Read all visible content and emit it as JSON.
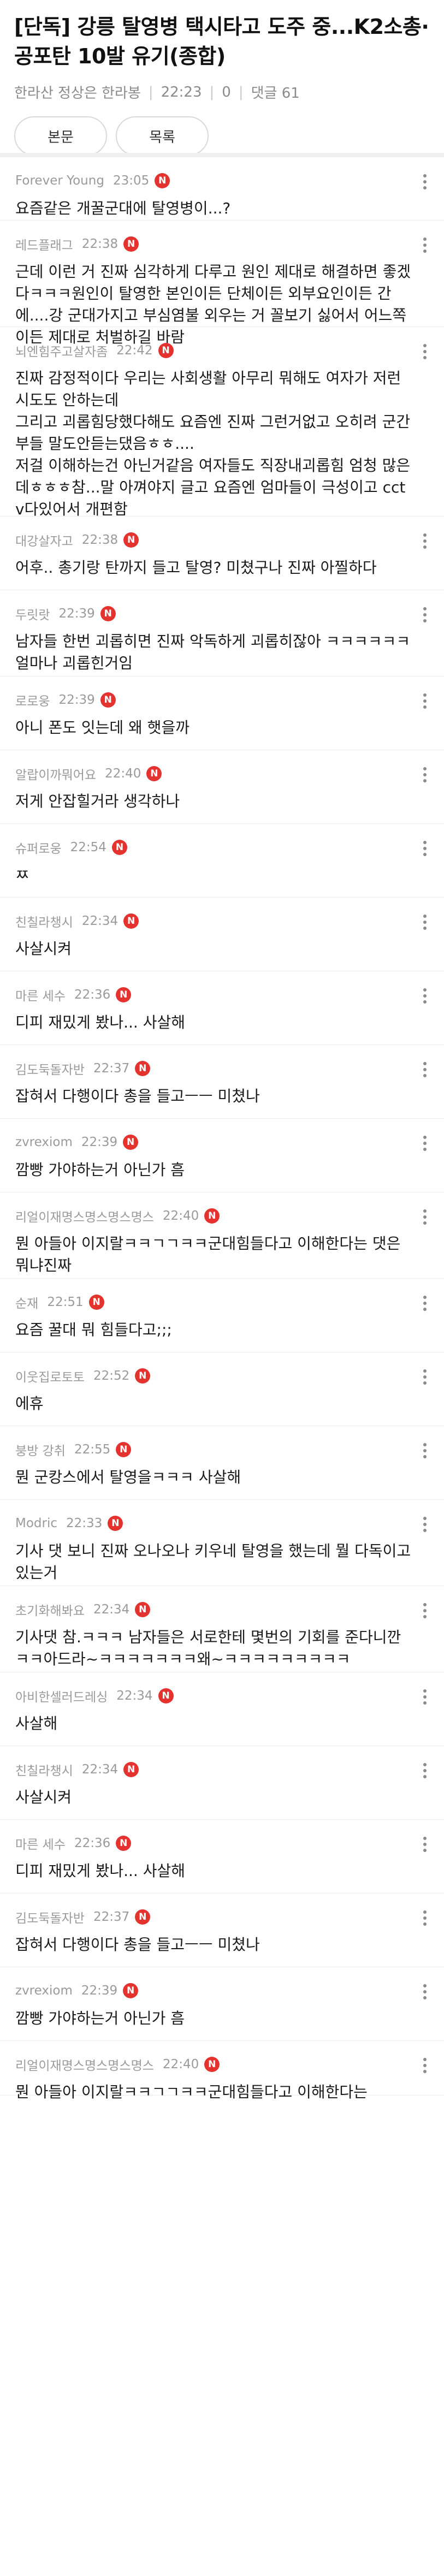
{
  "article": {
    "title": "[단독] 강릉 탈영병 택시타고 도주 중...K2소총·공포탄 10발 유기(종합)",
    "author": "한라산 정상은 한라봉",
    "time": "22:23",
    "views": "0",
    "comment_count_label": "댓글 61"
  },
  "buttons": {
    "body": "본문",
    "list": "목록"
  },
  "badge": "N",
  "colors": {
    "badge": "#e4332f",
    "meta_text": "#8a8a8a"
  },
  "comments": [
    {
      "user": "Forever Young",
      "time": "23:05",
      "text": "요즘같은 개꿀군대에 탈영병이...?"
    },
    {
      "user": "레드플래그",
      "time": "22:38",
      "text": "근데 이런 거 진짜 심각하게 다루고 원인 제대로 해결하면 좋겠다ㅋㅋㅋ원인이 탈영한 본인이든 단체이든 외부요인이든 간에....강 군대가지고 부심염불 외우는 거 꼴보기 싫어서 어느쪽이든 제대로 처벌하길 바람"
    },
    {
      "user": "뇌엔힘주고살자좀",
      "time": "22:42",
      "text": "진짜 감정적이다 우리는 사회생활 아무리 뭐해도 여자가 저런시도도 안하는데\n그리고 괴롭힘당했다해도 요즘엔 진짜 그런거없고 오히려 군간부들 말도안듣는댔음ㅎㅎ....\n저걸 이해하는건 아닌거같음 여자들도 직장내괴롭힘 엄청 많은데ㅎㅎㅎ참...말 아껴야지 글고 요즘엔 엄마들이 극성이고 cctv다있어서 개편함"
    },
    {
      "user": "대강살자고",
      "time": "22:38",
      "text": "어후.. 총기랑 탄까지 들고 탈영? 미쳤구나 진짜 아찔하다"
    },
    {
      "user": "두릿랏",
      "time": "22:39",
      "text": "남자들 한번 괴롭히면 진짜 악독하게 괴롭히잖아 ㅋㅋㅋㅋㅋㅋ 얼마나 괴롭힌거임"
    },
    {
      "user": "로로웅",
      "time": "22:39",
      "text": "아니 폰도 잇는데 왜 햇을까"
    },
    {
      "user": "알랍이까뭐어요",
      "time": "22:40",
      "text": "저게 안잡힐거라 생각하나"
    },
    {
      "user": "슈퍼로웅",
      "time": "22:54",
      "text": "ㅉ"
    },
    {
      "user": "친칠라챙시",
      "time": "22:34",
      "text": "사살시켜"
    },
    {
      "user": "마른 세수",
      "time": "22:36",
      "text": "디피 재밌게 봤나... 사살해"
    },
    {
      "user": "김도둑돌자반",
      "time": "22:37",
      "text": "잡혀서 다행이다 총을 들고ㅡㅡ 미쳤나"
    },
    {
      "user": "zvrexiom",
      "time": "22:39",
      "text": "깜빵 가야하는거 아닌가 흠"
    },
    {
      "user": "리얼이재명스명스명스명스",
      "time": "22:40",
      "text": "뭔 아들아 이지랄ㅋㅋㄱㄱㅋㅋ군대힘들다고 이해한다는 댓은 뭐냐진짜"
    },
    {
      "user": "순재",
      "time": "22:51",
      "text": "요즘 꿀대 뭐 힘들다고;;;"
    },
    {
      "user": "이웃집로토토",
      "time": "22:52",
      "text": "에휴"
    },
    {
      "user": "붕방 강취",
      "time": "22:55",
      "text": "뭔 군캉스에서 탈영을ㅋㅋㅋ 사살해"
    },
    {
      "user": "Modric",
      "time": "22:33",
      "text": "기사 댓 보니 진짜 오나오나 키우네 탈영을 했는데 뭘 다독이고 있는거"
    },
    {
      "user": "초기화해봐요",
      "time": "22:34",
      "text": "기사댓 참.ㅋㅋㅋ 남자들은 서로한테 몇번의 기회를 준다니깐ㅋㅋ아드라~ㅋㅋㅋㅋㅋㅋㅋ왜~ㅋㅋㅋㅋㅋㅋㅋㅋㅋ"
    },
    {
      "user": "아비한셀러드레싱",
      "time": "22:34",
      "text": "사살해"
    },
    {
      "user": "친칠라챙시",
      "time": "22:34",
      "text": "사살시켜"
    },
    {
      "user": "마른 세수",
      "time": "22:36",
      "text": "디피 재밌게 봤나... 사살해"
    },
    {
      "user": "김도둑돌자반",
      "time": "22:37",
      "text": "잡혀서 다행이다 총을 들고ㅡㅡ 미쳤나"
    },
    {
      "user": "zvrexiom",
      "time": "22:39",
      "text": "깜빵 가야하는거 아닌가 흠"
    },
    {
      "user": "리얼이재명스명스명스명스",
      "time": "22:40",
      "text": "뭔 아들아 이지랄ㅋㅋㄱㄱㅋㅋ군대힘들다고 이해한다는"
    }
  ]
}
